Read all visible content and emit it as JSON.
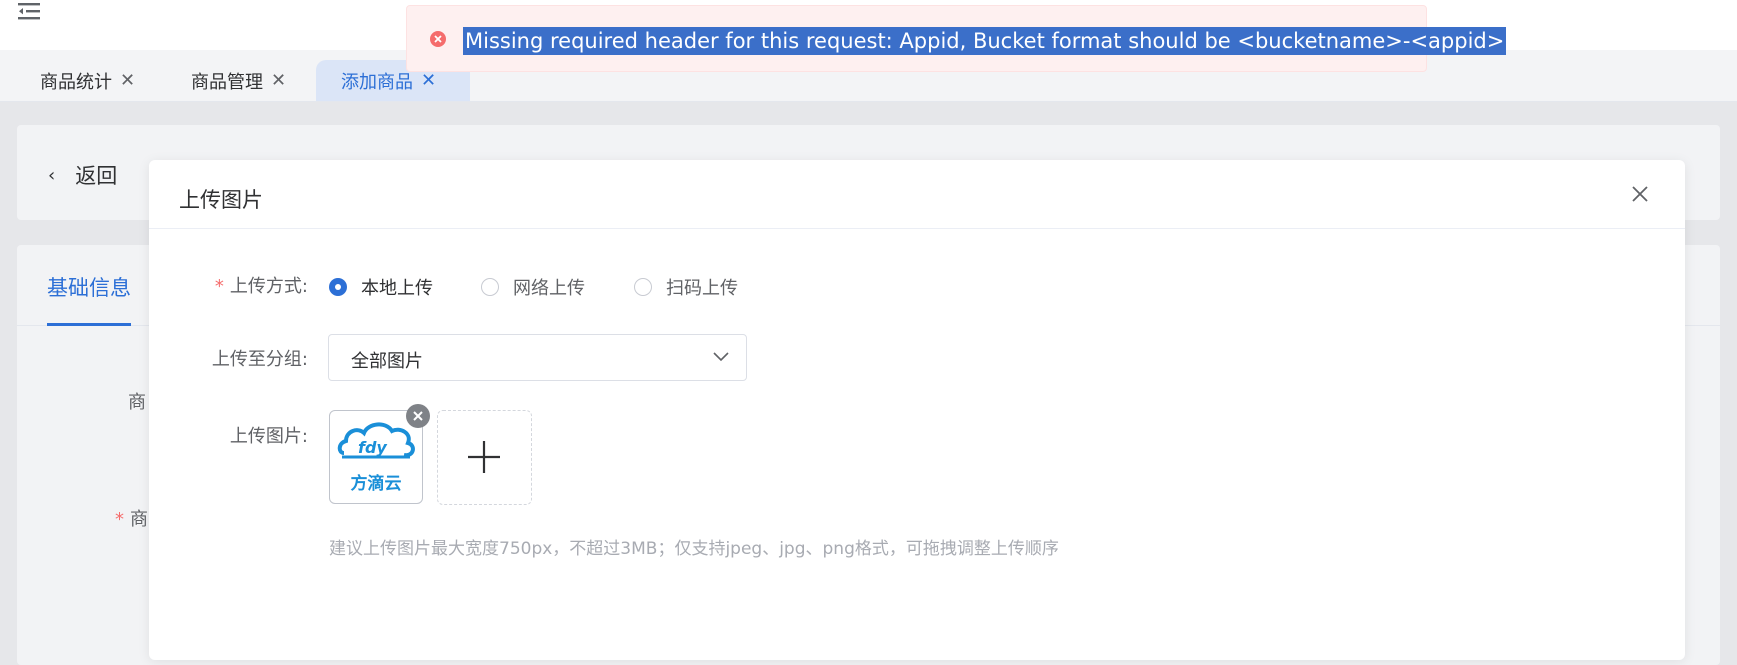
{
  "tabs": [
    {
      "label": "商品统计",
      "active": false
    },
    {
      "label": "商品管理",
      "active": false
    },
    {
      "label": "添加商品",
      "active": true
    }
  ],
  "page": {
    "back_label": "返回",
    "section_tab": "基础信息",
    "bg_label_1": "商",
    "bg_label_2": "商"
  },
  "dialog": {
    "title": "上传图片",
    "upload_method_label": "上传方式:",
    "upload_methods": [
      {
        "label": "本地上传",
        "checked": true
      },
      {
        "label": "网络上传",
        "checked": false
      },
      {
        "label": "扫码上传",
        "checked": false
      }
    ],
    "group_label": "上传至分组:",
    "group_value": "全部图片",
    "image_label": "上传图片:",
    "thumb_logo_text": "方滴云",
    "hint": "建议上传图片最大宽度750px，不超过3MB；仅支持jpeg、jpg、png格式，可拖拽调整上传顺序"
  },
  "toast": {
    "message": "Missing required header for this request: Appid, Bucket format should be <bucketname>-<appid>"
  },
  "colors": {
    "primary": "#2c6fd6",
    "error": "#f56c6c",
    "toast_bg": "#fef0f0",
    "selection": "#3b6fc9"
  }
}
